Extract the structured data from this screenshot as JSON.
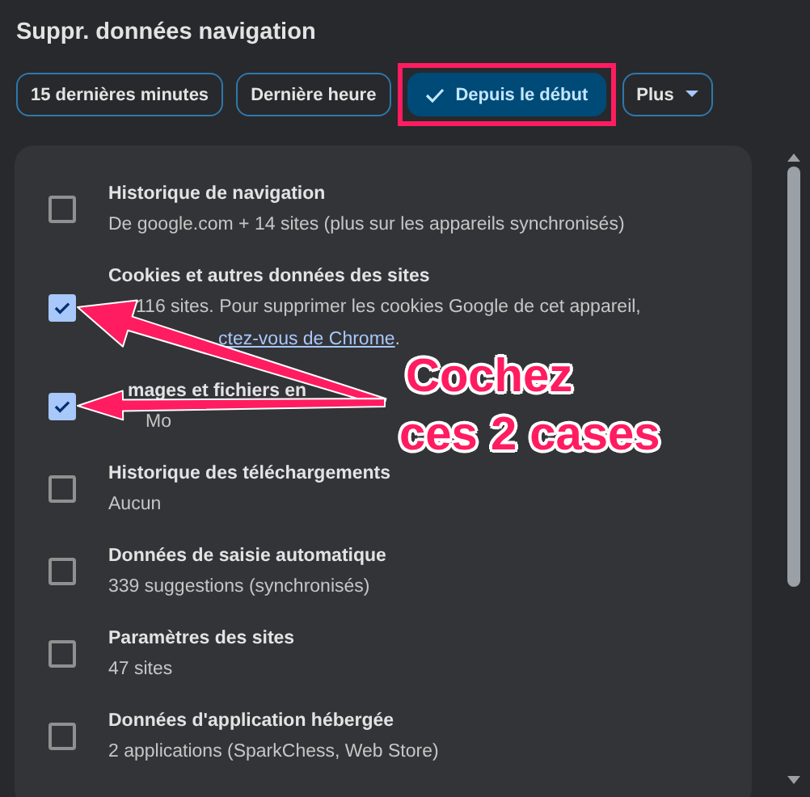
{
  "title": "Suppr. données navigation",
  "ranges": [
    {
      "label": "15 dernières minutes",
      "selected": false,
      "highlighted": false
    },
    {
      "label": "Dernière heure",
      "selected": false,
      "highlighted": false
    },
    {
      "label": "Depuis le début",
      "selected": true,
      "highlighted": true
    },
    {
      "label": "Plus",
      "selected": false,
      "highlighted": false,
      "kind": "dropdown"
    }
  ],
  "items": [
    {
      "title": "Historique de navigation",
      "desc": "De google.com + 14 sites (plus sur les appareils synchronisés)",
      "checked": false
    },
    {
      "title": "Cookies et autres données des sites",
      "desc": "116 sites. Pour supprimer les cookies Google de cet appareil,",
      "link": "ctez-vous de Chrome",
      "desc_end": ".",
      "checked": true
    },
    {
      "title": "mages et fichiers en",
      "desc": "Mo",
      "checked": true
    },
    {
      "title": "Historique des téléchargements",
      "desc": "Aucun",
      "checked": false
    },
    {
      "title": "Données de saisie automatique",
      "desc": "339 suggestions (synchronisés)",
      "checked": false
    },
    {
      "title": "Paramètres des sites",
      "desc": "47 sites",
      "checked": false
    },
    {
      "title": "Données d'application hébergée",
      "desc": "2 applications (SparkChess, Web Store)",
      "checked": false
    }
  ],
  "annotation": {
    "lines": [
      "Cochez",
      "ces 2 cases"
    ]
  }
}
